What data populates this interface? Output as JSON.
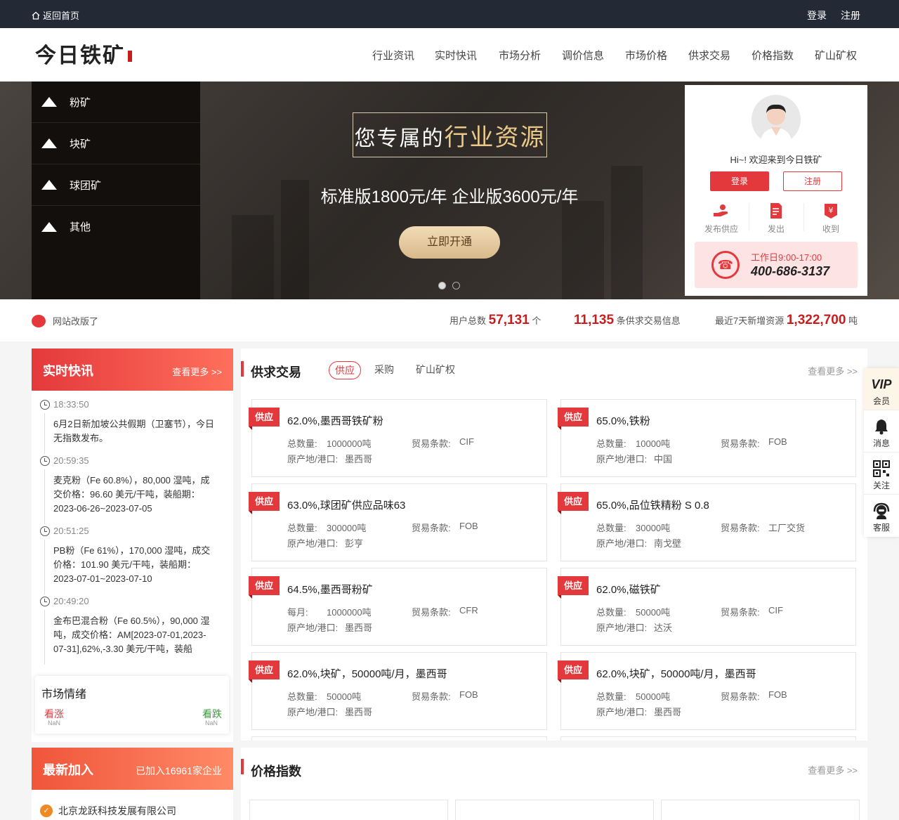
{
  "topbar": {
    "home": "返回首页",
    "login": "登录",
    "register": "注册"
  },
  "logo": {
    "text": "今日铁矿"
  },
  "nav": [
    "行业资讯",
    "实时快讯",
    "市场分析",
    "调价信息",
    "市场价格",
    "供求交易",
    "价格指数",
    "矿山矿权"
  ],
  "categories": [
    "粉矿",
    "块矿",
    "球团矿",
    "其他"
  ],
  "promo": {
    "title_a": "您专属的",
    "title_b": "行业资源",
    "subtitle": "标准版1800元/年  企业版3600元/年",
    "button": "立即开通"
  },
  "user_box": {
    "welcome": "Hi~! 欢迎来到今日铁矿",
    "login": "登录",
    "register": "注册",
    "actions": [
      "发布供应",
      "发出",
      "收到"
    ],
    "hours": "工作日9:00-17:00",
    "phone": "400-686-3137"
  },
  "stats": {
    "notice": "网站改版了",
    "users_label": "用户总数",
    "users_value": "57,131",
    "users_unit": "个",
    "trades_value": "11,135",
    "trades_label": "条供求交易信息",
    "recent_label": "最近7天新增资源",
    "recent_value": "1,322,700",
    "recent_unit": "吨"
  },
  "flash": {
    "title": "实时快讯",
    "more": "查看更多 >>",
    "items": [
      {
        "time": "18:33:50",
        "text": "6月2日新加坡公共假期（卫塞节），今日无指数发布。"
      },
      {
        "time": "20:59:35",
        "text": "麦克粉（Fe 60.8%），80,000 湿吨，成交价格：96.60 美元/干吨，装船期：2023-06-26~2023-07-05"
      },
      {
        "time": "20:51:25",
        "text": "PB粉（Fe 61%），170,000 湿吨，成交价格：101.90 美元/干吨，装船期：2023-07-01~2023-07-10"
      },
      {
        "time": "20:49:20",
        "text": "金布巴混合粉（Fe 60.5%），90,000 湿吨，成交价格：AM[2023-07-01,2023-07-31],62%,-3.30 美元/干吨，装船"
      }
    ]
  },
  "mood": {
    "title": "市场情绪",
    "up": "看涨",
    "down": "看跌",
    "up_val": "NaN",
    "down_val": "NaN"
  },
  "newest": {
    "title": "最新加入",
    "count": "已加入16961家企业",
    "company": "北京龙跃科技发展有限公司"
  },
  "trade": {
    "title": "供求交易",
    "tabs": [
      "供应",
      "采购",
      "矿山矿权"
    ],
    "more": "查看更多 >>",
    "tag": "供应",
    "cards": [
      {
        "title": "62.0%,墨西哥铁矿粉",
        "qty_label": "总数量:",
        "qty": "1000000吨",
        "terms_label": "贸易条款:",
        "terms": "CIF",
        "origin_label": "原产地/港口:",
        "origin": "墨西哥"
      },
      {
        "title": "65.0%,铁粉",
        "qty_label": "总数量:",
        "qty": "10000吨",
        "terms_label": "贸易条款:",
        "terms": "FOB",
        "origin_label": "原产地/港口:",
        "origin": "中国"
      },
      {
        "title": "63.0%,球团矿供应品味63",
        "qty_label": "总数量:",
        "qty": "300000吨",
        "terms_label": "贸易条款:",
        "terms": "FOB",
        "origin_label": "原产地/港口:",
        "origin": "彭亨"
      },
      {
        "title": "65.0%,品位铁精粉 S 0.8",
        "qty_label": "总数量:",
        "qty": "30000吨",
        "terms_label": "贸易条款:",
        "terms": "工厂交货",
        "origin_label": "原产地/港口:",
        "origin": "南戈壁"
      },
      {
        "title": "64.5%,墨西哥粉矿",
        "qty_label": "每月:",
        "qty": "1000000吨",
        "terms_label": "贸易条款:",
        "terms": "CFR",
        "origin_label": "原产地/港口:",
        "origin": "墨西哥"
      },
      {
        "title": "62.0%,磁铁矿",
        "qty_label": "总数量:",
        "qty": "50000吨",
        "terms_label": "贸易条款:",
        "terms": "CIF",
        "origin_label": "原产地/港口:",
        "origin": "达沃"
      },
      {
        "title": "62.0%,块矿，50000吨/月，墨西哥",
        "qty_label": "总数量:",
        "qty": "50000吨",
        "terms_label": "贸易条款:",
        "terms": "FOB",
        "origin_label": "原产地/港口:",
        "origin": "墨西哥"
      },
      {
        "title": "62.0%,块矿，50000吨/月，墨西哥",
        "qty_label": "总数量:",
        "qty": "50000吨",
        "terms_label": "贸易条款:",
        "terms": "FOB",
        "origin_label": "原产地/港口:",
        "origin": "墨西哥"
      }
    ]
  },
  "index": {
    "title": "价格指数",
    "more": "查看更多 >>"
  },
  "sidebar": [
    "会员",
    "消息",
    "关注",
    "客服"
  ],
  "colors": {
    "accent": "#e4393c",
    "dark": "#232a36"
  }
}
